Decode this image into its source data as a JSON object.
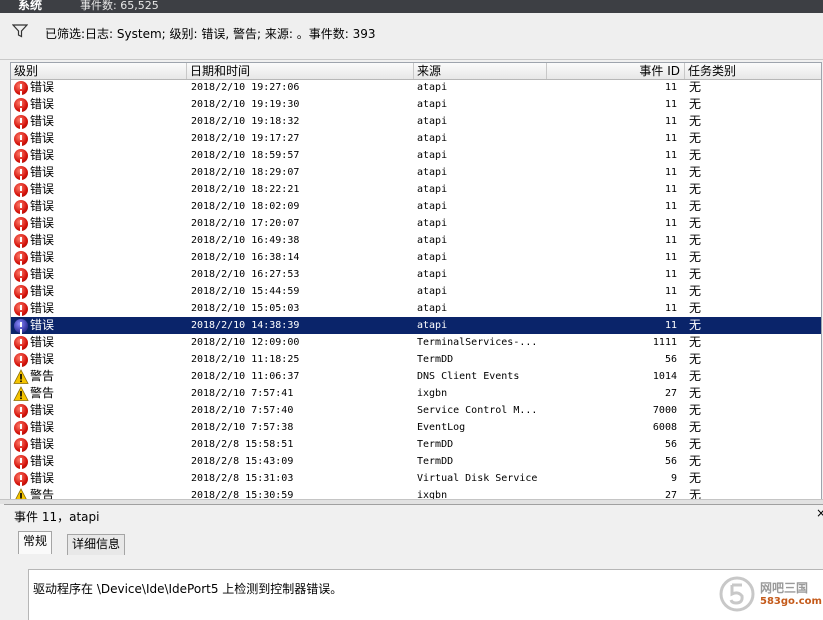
{
  "titlebar": {
    "title": "系统",
    "count": "事件数: 65,525"
  },
  "filter": {
    "text": "已筛选:日志: System; 级别: 错误, 警告; 来源: 。事件数: 393"
  },
  "columns": {
    "level": "级别",
    "datetime": "日期和时间",
    "source": "来源",
    "event_id": "事件 ID",
    "task": "任务类别"
  },
  "events": [
    {
      "icon": "error-icon",
      "level": "错误",
      "datetime": "2018/2/10 19:27:06",
      "source": "atapi",
      "id": "11",
      "task": "无"
    },
    {
      "icon": "error-icon",
      "level": "错误",
      "datetime": "2018/2/10 19:19:30",
      "source": "atapi",
      "id": "11",
      "task": "无"
    },
    {
      "icon": "error-icon",
      "level": "错误",
      "datetime": "2018/2/10 19:18:32",
      "source": "atapi",
      "id": "11",
      "task": "无"
    },
    {
      "icon": "error-icon",
      "level": "错误",
      "datetime": "2018/2/10 19:17:27",
      "source": "atapi",
      "id": "11",
      "task": "无"
    },
    {
      "icon": "error-icon",
      "level": "错误",
      "datetime": "2018/2/10 18:59:57",
      "source": "atapi",
      "id": "11",
      "task": "无"
    },
    {
      "icon": "error-icon",
      "level": "错误",
      "datetime": "2018/2/10 18:29:07",
      "source": "atapi",
      "id": "11",
      "task": "无"
    },
    {
      "icon": "error-icon",
      "level": "错误",
      "datetime": "2018/2/10 18:22:21",
      "source": "atapi",
      "id": "11",
      "task": "无"
    },
    {
      "icon": "error-icon",
      "level": "错误",
      "datetime": "2018/2/10 18:02:09",
      "source": "atapi",
      "id": "11",
      "task": "无"
    },
    {
      "icon": "error-icon",
      "level": "错误",
      "datetime": "2018/2/10 17:20:07",
      "source": "atapi",
      "id": "11",
      "task": "无"
    },
    {
      "icon": "error-icon",
      "level": "错误",
      "datetime": "2018/2/10 16:49:38",
      "source": "atapi",
      "id": "11",
      "task": "无"
    },
    {
      "icon": "error-icon",
      "level": "错误",
      "datetime": "2018/2/10 16:38:14",
      "source": "atapi",
      "id": "11",
      "task": "无"
    },
    {
      "icon": "error-icon",
      "level": "错误",
      "datetime": "2018/2/10 16:27:53",
      "source": "atapi",
      "id": "11",
      "task": "无"
    },
    {
      "icon": "error-icon",
      "level": "错误",
      "datetime": "2018/2/10 15:44:59",
      "source": "atapi",
      "id": "11",
      "task": "无"
    },
    {
      "icon": "error-icon",
      "level": "错误",
      "datetime": "2018/2/10 15:05:03",
      "source": "atapi",
      "id": "11",
      "task": "无"
    },
    {
      "icon": "error-icon",
      "level": "错误",
      "datetime": "2018/2/10 14:38:39",
      "source": "atapi",
      "id": "11",
      "task": "无",
      "selected": true
    },
    {
      "icon": "error-icon",
      "level": "错误",
      "datetime": "2018/2/10 12:09:00",
      "source": "TerminalServices-...",
      "id": "1111",
      "task": "无"
    },
    {
      "icon": "error-icon",
      "level": "错误",
      "datetime": "2018/2/10 11:18:25",
      "source": "TermDD",
      "id": "56",
      "task": "无"
    },
    {
      "icon": "warning-icon",
      "level": "警告",
      "datetime": "2018/2/10 11:06:37",
      "source": "DNS Client Events",
      "id": "1014",
      "task": "无"
    },
    {
      "icon": "warning-icon",
      "level": "警告",
      "datetime": "2018/2/10 7:57:41",
      "source": "ixgbn",
      "id": "27",
      "task": "无"
    },
    {
      "icon": "error-icon",
      "level": "错误",
      "datetime": "2018/2/10 7:57:40",
      "source": "Service Control M...",
      "id": "7000",
      "task": "无"
    },
    {
      "icon": "error-icon",
      "level": "错误",
      "datetime": "2018/2/10 7:57:38",
      "source": "EventLog",
      "id": "6008",
      "task": "无"
    },
    {
      "icon": "error-icon",
      "level": "错误",
      "datetime": "2018/2/8 15:58:51",
      "source": "TermDD",
      "id": "56",
      "task": "无"
    },
    {
      "icon": "error-icon",
      "level": "错误",
      "datetime": "2018/2/8 15:43:09",
      "source": "TermDD",
      "id": "56",
      "task": "无"
    },
    {
      "icon": "error-icon",
      "level": "错误",
      "datetime": "2018/2/8 15:31:03",
      "source": "Virtual Disk Service",
      "id": "9",
      "task": "无"
    },
    {
      "icon": "warning-icon",
      "level": "警告",
      "datetime": "2018/2/8 15:30:59",
      "source": "ixgbn",
      "id": "27",
      "task": "无"
    }
  ],
  "details": {
    "title": "事件 11，atapi",
    "close": "×",
    "tabs": [
      "常规",
      "详细信息"
    ],
    "message": "驱动程序在 \\Device\\Ide\\IdePort5 上检测到控制器错误。"
  },
  "watermark": {
    "line1": "网吧三国",
    "line2": "583go.com"
  },
  "colors": {
    "selection": "#0a246a",
    "error": "#d3120a",
    "warning": "#f5c400"
  }
}
